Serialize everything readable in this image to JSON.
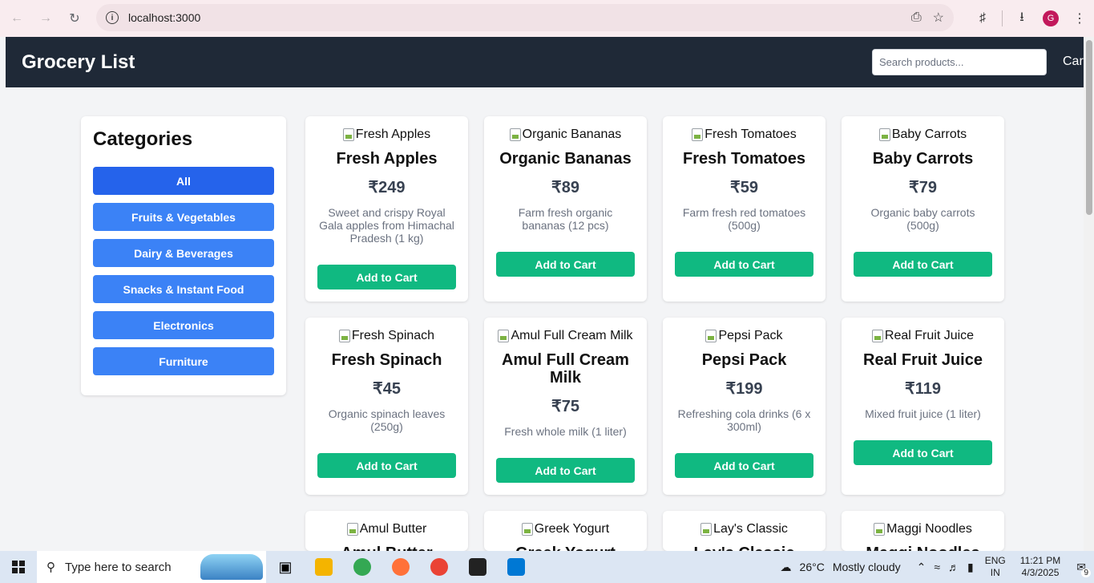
{
  "browser": {
    "url": "localhost:3000",
    "profile_initial": "G"
  },
  "header": {
    "title": "Grocery List",
    "search_placeholder": "Search products...",
    "cart_label": "Cart"
  },
  "sidebar": {
    "title": "Categories",
    "categories": [
      {
        "label": "All",
        "active": true
      },
      {
        "label": "Fruits & Vegetables",
        "active": false
      },
      {
        "label": "Dairy & Beverages",
        "active": false
      },
      {
        "label": "Snacks & Instant Food",
        "active": false
      },
      {
        "label": "Electronics",
        "active": false
      },
      {
        "label": "Furniture",
        "active": false
      }
    ]
  },
  "products": [
    {
      "image_alt": "Fresh Apples",
      "name": "Fresh Apples",
      "price": "₹249",
      "description": "Sweet and crispy Royal Gala apples from Himachal Pradesh (1 kg)",
      "button": "Add to Cart"
    },
    {
      "image_alt": "Organic Bananas",
      "name": "Organic Bananas",
      "price": "₹89",
      "description": "Farm fresh organic bananas (12 pcs)",
      "button": "Add to Cart"
    },
    {
      "image_alt": "Fresh Tomatoes",
      "name": "Fresh Tomatoes",
      "price": "₹59",
      "description": "Farm fresh red tomatoes (500g)",
      "button": "Add to Cart"
    },
    {
      "image_alt": "Baby Carrots",
      "name": "Baby Carrots",
      "price": "₹79",
      "description": "Organic baby carrots (500g)",
      "button": "Add to Cart"
    },
    {
      "image_alt": "Fresh Spinach",
      "name": "Fresh Spinach",
      "price": "₹45",
      "description": "Organic spinach leaves (250g)",
      "button": "Add to Cart"
    },
    {
      "image_alt": "Amul Full Cream Milk",
      "name": "Amul Full Cream Milk",
      "price": "₹75",
      "description": "Fresh whole milk (1 liter)",
      "button": "Add to Cart"
    },
    {
      "image_alt": "Pepsi Pack",
      "name": "Pepsi Pack",
      "price": "₹199",
      "description": "Refreshing cola drinks (6 x 300ml)",
      "button": "Add to Cart"
    },
    {
      "image_alt": "Real Fruit Juice",
      "name": "Real Fruit Juice",
      "price": "₹119",
      "description": "Mixed fruit juice (1 liter)",
      "button": "Add to Cart"
    },
    {
      "image_alt": "Amul Butter",
      "name": "Amul Butter"
    },
    {
      "image_alt": "Greek Yogurt",
      "name": "Greek Yogurt"
    },
    {
      "image_alt": "Lay's Classic",
      "name": "Lay's Classic"
    },
    {
      "image_alt": "Maggi Noodles",
      "name": "Maggi Noodles"
    }
  ],
  "taskbar": {
    "search_placeholder": "Type here to search",
    "weather_temp": "26°C",
    "weather_text": "Mostly cloudy",
    "lang_top": "ENG",
    "lang_bottom": "IN",
    "time": "11:21 PM",
    "date": "4/3/2025",
    "notification_count": "9"
  },
  "colors": {
    "header_bg": "#1f2937",
    "category_btn": "#3b82f6",
    "category_active": "#2563eb",
    "add_to_cart": "#10b981"
  }
}
